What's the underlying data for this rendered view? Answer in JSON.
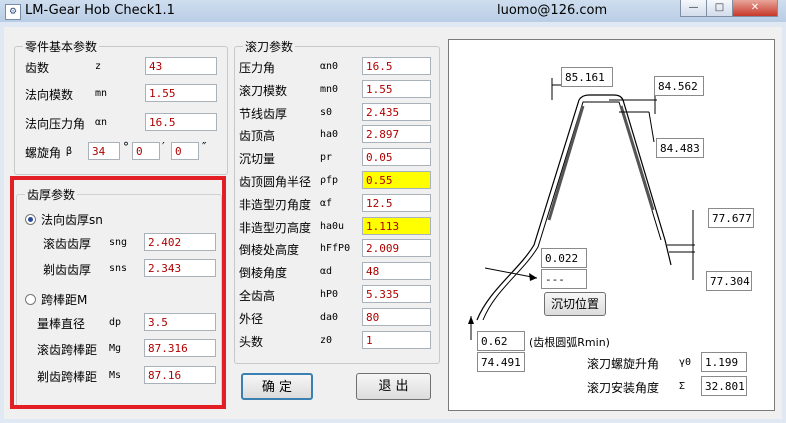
{
  "window": {
    "title": "LM-Gear Hob Check1.1",
    "email": "luomo@126.com",
    "minimize_glyph": "—",
    "restore_glyph": "□",
    "close_glyph": "✕"
  },
  "part": {
    "legend": "零件基本参数",
    "fields": [
      {
        "label": "齿数",
        "symbol": "z",
        "value": "43"
      },
      {
        "label": "法向模数",
        "symbol": "mn",
        "value": "1.55"
      },
      {
        "label": "法向压力角",
        "symbol": "αn",
        "value": "16.5"
      }
    ],
    "helix": {
      "label": "螺旋角",
      "symbol": "β",
      "deg": "34",
      "min": "0",
      "sec": "0",
      "deg_mark": "°",
      "min_mark": "′",
      "sec_mark": "″"
    }
  },
  "thickness": {
    "legend": "齿厚参数",
    "option_sn": "法向齿厚sn",
    "sng": {
      "label": "滚齿齿厚",
      "symbol": "sng",
      "value": "2.402"
    },
    "sns": {
      "label": "剃齿齿厚",
      "symbol": "sns",
      "value": "2.343"
    },
    "option_m": "跨棒距M",
    "dp": {
      "label": "量棒直径",
      "symbol": "dp",
      "value": "3.5"
    },
    "mg": {
      "label": "滚齿跨棒距",
      "symbol": "Mg",
      "value": "87.316"
    },
    "ms": {
      "label": "剃齿跨棒距",
      "symbol": "Ms",
      "value": "87.16"
    },
    "selected": "sn"
  },
  "hob": {
    "legend": "滚刀参数",
    "fields": [
      {
        "label": "压力角",
        "symbol": "αn0",
        "value": "16.5",
        "highlight": false
      },
      {
        "label": "滚刀模数",
        "symbol": "mn0",
        "value": "1.55",
        "highlight": false
      },
      {
        "label": "节线齿厚",
        "symbol": "s0",
        "value": "2.435",
        "highlight": false
      },
      {
        "label": "齿顶高",
        "symbol": "ha0",
        "value": "2.897",
        "highlight": false
      },
      {
        "label": "沉切量",
        "symbol": "pr",
        "value": "0.05",
        "highlight": false
      },
      {
        "label": "齿顶圆角半径",
        "symbol": "ρfp",
        "value": "0.55",
        "highlight": true
      },
      {
        "label": "非造型刃角度",
        "symbol": "αf",
        "value": "12.5",
        "highlight": false
      },
      {
        "label": "非造型刃高度",
        "symbol": "ha0u",
        "value": "1.113",
        "highlight": true
      },
      {
        "label": "倒棱处高度",
        "symbol": "hFfP0",
        "value": "2.009",
        "highlight": false
      },
      {
        "label": "倒棱角度",
        "symbol": "αd",
        "value": "48",
        "highlight": false
      },
      {
        "label": "全齿高",
        "symbol": "hP0",
        "value": "5.335",
        "highlight": false
      },
      {
        "label": "外径",
        "symbol": "da0",
        "value": "80",
        "highlight": false
      },
      {
        "label": "头数",
        "symbol": "z0",
        "value": "1",
        "highlight": false
      }
    ]
  },
  "buttons": {
    "ok": "确  定",
    "exit": "退  出"
  },
  "diagram": {
    "top_width": "85.161",
    "right_upper_1": "84.562",
    "right_upper_2": "84.483",
    "right_lower_1": "77.677",
    "right_lower_2": "77.304",
    "undercut_value": "0.022",
    "undercut_dash": "---",
    "undercut_button": "沉切位置",
    "root_radius": "0.62",
    "root_radius_label": "(齿根圆弧Rmin)",
    "root_dia": "74.491",
    "lead_angle": {
      "label": "滚刀螺旋升角",
      "symbol": "γ0",
      "value": "1.199"
    },
    "install_angle": {
      "label": "滚刀安装角度",
      "symbol": "Σ",
      "value": "32.801"
    }
  }
}
